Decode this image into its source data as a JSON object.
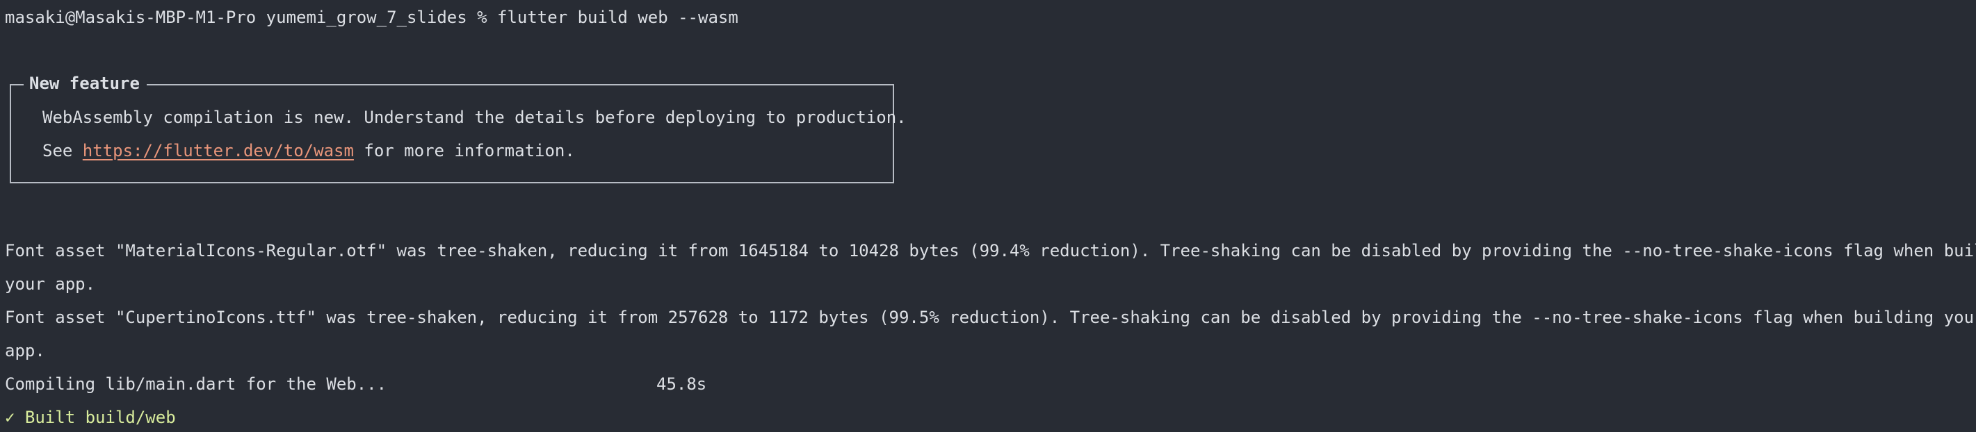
{
  "prompt": {
    "text": "masaki@Masakis-MBP-M1-Pro yumemi_grow_7_slides % flutter build web --wasm"
  },
  "notice": {
    "title": "New feature",
    "line1": "WebAssembly compilation is new. Understand the details before deploying to production.",
    "line2_prefix": "See ",
    "link": "https://flutter.dev/to/wasm",
    "line2_suffix": " for more information."
  },
  "output": {
    "material_line1": "Font asset \"MaterialIcons-Regular.otf\" was tree-shaken, reducing it from 1645184 to 10428 bytes (99.4% reduction). Tree-shaking can be disabled by providing the --no-tree-shake-icons flag when building",
    "material_line2": "your app.",
    "cupertino_line1": "Font asset \"CupertinoIcons.ttf\" was tree-shaken, reducing it from 257628 to 1172 bytes (99.5% reduction). Tree-shaking can be disabled by providing the --no-tree-shake-icons flag when building your",
    "cupertino_line2": "app.",
    "compiling": "Compiling lib/main.dart for the Web...",
    "compile_time": "45.8s",
    "built_check": "✓",
    "built": "Built build/web"
  },
  "colors": {
    "background": "#282c34",
    "text": "#dcdfe4",
    "link": "#e8957a",
    "success": "#d8ec9c"
  }
}
